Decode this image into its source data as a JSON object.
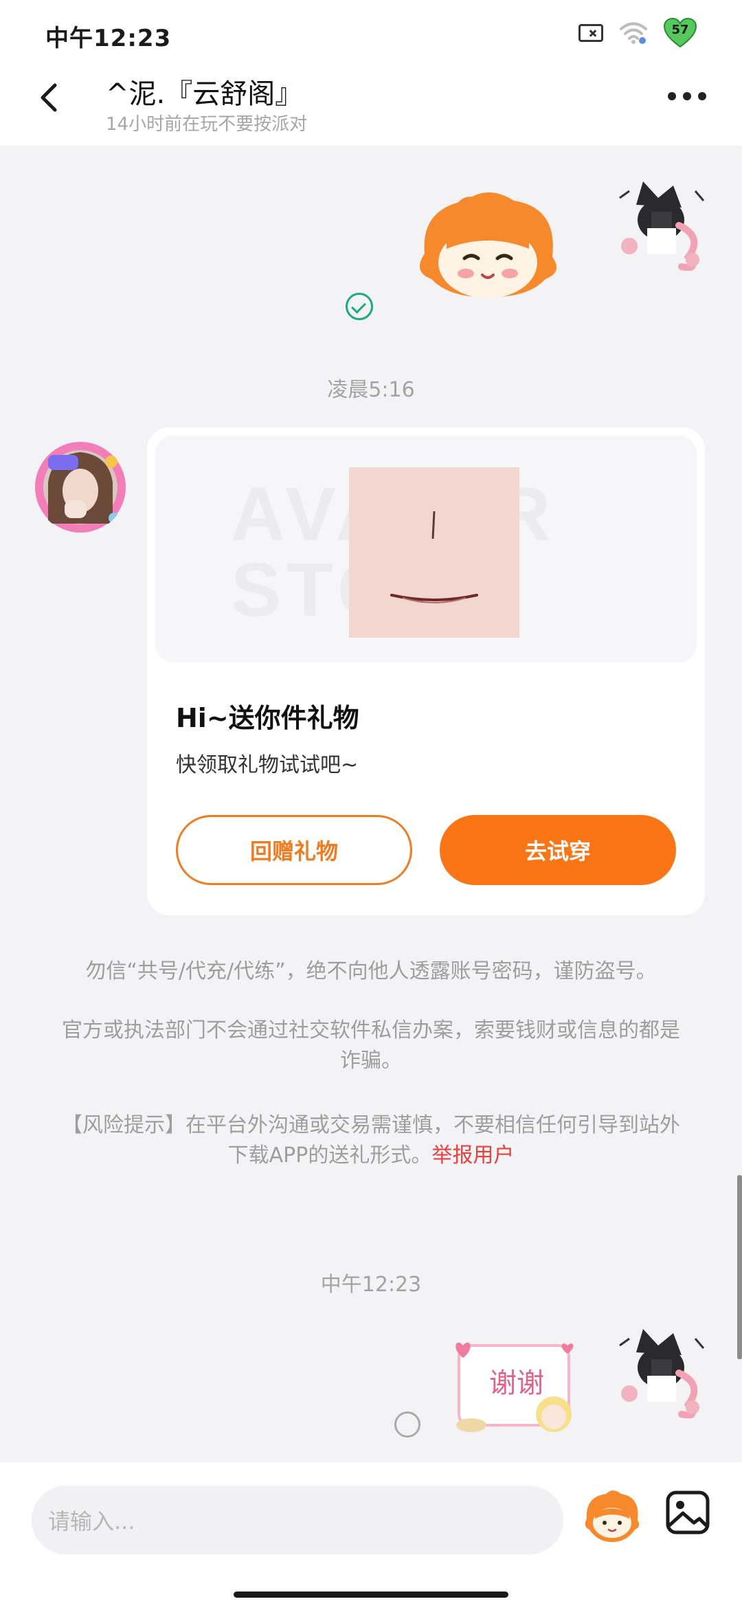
{
  "status_bar": {
    "time": "中午12:23",
    "battery": "57",
    "icons": [
      "sim-off-icon",
      "wifi-icon",
      "battery-heart-icon"
    ]
  },
  "header": {
    "title": "^泥.『云舒阁』",
    "subtitle": "14小时前在玩不要按派对",
    "back_icon": "back-arrow-icon",
    "more_icon": "more-dots-icon"
  },
  "messages": {
    "time_1": "凌晨5:16",
    "gift_card": {
      "watermark": "AVATAR STORE",
      "title": "Hi~送你件礼物",
      "description": "快领取礼物试试吧~",
      "return_button": "回赠礼物",
      "try_button": "去试穿"
    },
    "notice_1": "勿信“共号/代充/代练”，绝不向他人透露账号密码，谨防盗号。",
    "notice_2": "官方或执法部门不会通过社交软件私信办案，索要钱财或信息的都是诈骗。",
    "notice_3": "【风险提示】在平台外沟通或交易需谨慎，不要相信任何引导到站外下载APP的送礼形式。",
    "report_link": "举报用户",
    "time_2": "中午12:23",
    "sticker_text": "谢谢"
  },
  "input_bar": {
    "placeholder": "请输入...",
    "emoji_icon": "mascot-emoji-icon",
    "image_icon": "image-icon"
  },
  "colors": {
    "accent": "#f97515",
    "report": "#e8413c",
    "read_check": "#1aab7a",
    "background": "#f3f3f6"
  }
}
